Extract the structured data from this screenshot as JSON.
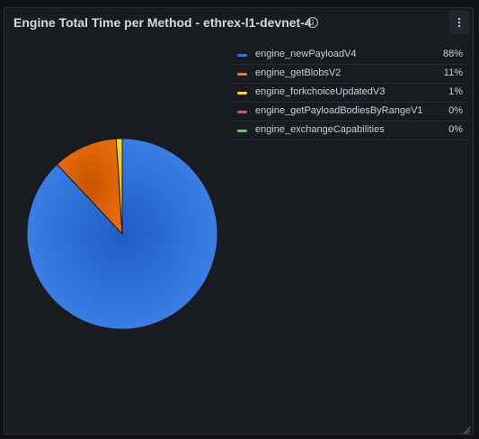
{
  "panel": {
    "title": "Engine Total Time per Method - ethrex-l1-devnet-4",
    "info_icon": "info-circle-icon",
    "menu_icon": "vertical-ellipsis-icon"
  },
  "chart_data": {
    "type": "pie",
    "legend_placement": "right",
    "slices": [
      {
        "label": "engine_newPayloadV4",
        "value": 88,
        "display": "88%",
        "color": "#3274d9"
      },
      {
        "label": "engine_getBlobsV2",
        "value": 11,
        "display": "11%",
        "color": "#ff780a"
      },
      {
        "label": "engine_forkchoiceUpdatedV3",
        "value": 1,
        "display": "1%",
        "color": "#fade2a"
      },
      {
        "label": "engine_getPayloadBodiesByRangeV1",
        "value": 0,
        "display": "0%",
        "color": "#f2495c"
      },
      {
        "label": "engine_exchangeCapabilities",
        "value": 0,
        "display": "0%",
        "color": "#73bf69"
      }
    ]
  }
}
